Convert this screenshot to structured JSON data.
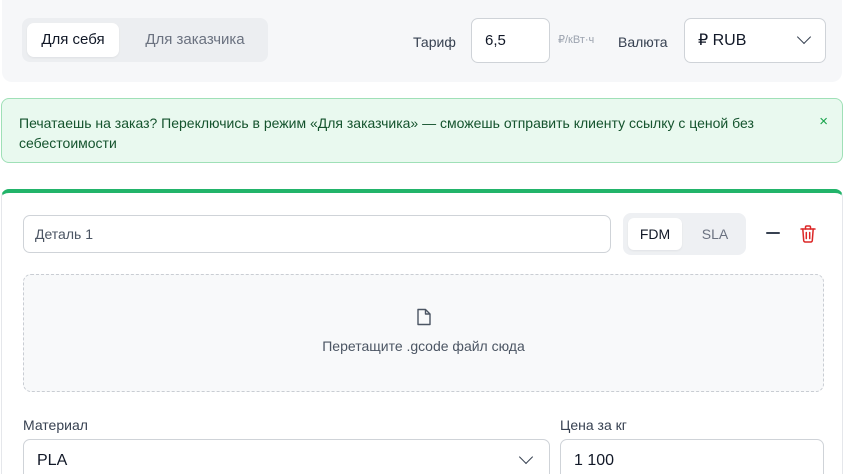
{
  "mode_switch": {
    "self_label": "Для себя",
    "customer_label": "Для заказчика"
  },
  "tariff": {
    "label": "Тариф",
    "value": "6,5",
    "unit": "₽/кВт·ч"
  },
  "currency": {
    "label": "Валюта",
    "value": "₽ RUB"
  },
  "notice": {
    "text": "Печатаешь на заказ? Переключись в режим «Для заказчика» — сможешь отправить клиенту ссылку с ценой без себестоимости",
    "close": "×"
  },
  "part": {
    "name_placeholder": "Деталь 1",
    "tech": {
      "fdm": "FDM",
      "sla": "SLA"
    },
    "dropzone_text": "Перетащите .gcode файл сюда",
    "material": {
      "label": "Материал",
      "value": "PLA"
    },
    "price": {
      "label": "Цена за кг",
      "value": "1 100"
    }
  },
  "colors": {
    "accent": "#22b46a",
    "notice_bg": "#e9f9ef",
    "delete": "#dc2626"
  }
}
